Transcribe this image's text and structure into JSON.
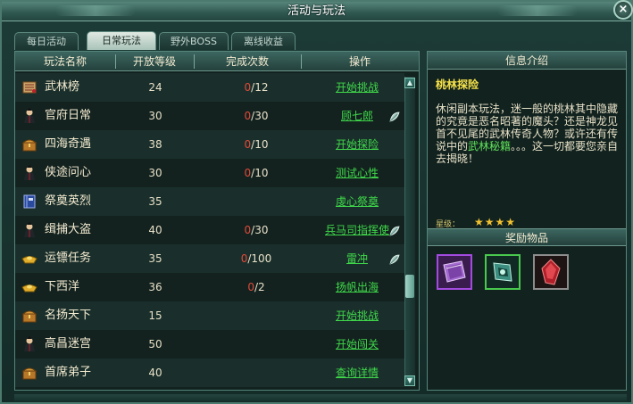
{
  "window": {
    "title": "活动与玩法",
    "close_glyph": "×"
  },
  "tabs": [
    {
      "label": "每日活动",
      "active": false
    },
    {
      "label": "日常玩法",
      "active": true
    },
    {
      "label": "野外BOSS",
      "active": false
    },
    {
      "label": "离线收益",
      "active": false
    }
  ],
  "table": {
    "headers": [
      "玩法名称",
      "开放等级",
      "完成次数",
      "操作"
    ],
    "rows": [
      {
        "icon": "scroll-icon",
        "name": "武林榜",
        "level": "24",
        "done": "0",
        "total": "/12",
        "action": "开始挑战",
        "leaf": false
      },
      {
        "icon": "npc-portrait-icon",
        "name": "官府日常",
        "level": "30",
        "done": "0",
        "total": "/30",
        "action": "顾七郎",
        "leaf": true
      },
      {
        "icon": "chest-icon",
        "name": "四海奇遇",
        "level": "38",
        "done": "0",
        "total": "/10",
        "action": "开始探险",
        "leaf": false
      },
      {
        "icon": "npc-portrait-icon",
        "name": "侠途问心",
        "level": "30",
        "done": "0",
        "total": "/10",
        "action": "测试心性",
        "leaf": false
      },
      {
        "icon": "book-icon",
        "name": "祭奠英烈",
        "level": "35",
        "done": "",
        "total": "",
        "action": "虔心祭奠",
        "leaf": false
      },
      {
        "icon": "npc-portrait-icon",
        "name": "缉捕大盗",
        "level": "40",
        "done": "0",
        "total": "/30",
        "action": "兵马司指挥使",
        "leaf": true
      },
      {
        "icon": "gold-ingot-icon",
        "name": "运镖任务",
        "level": "35",
        "done": "0",
        "total": "/100",
        "action": "雷冲",
        "leaf": true
      },
      {
        "icon": "gold-ingot-icon",
        "name": "下西洋",
        "level": "36",
        "done": "0",
        "total": "/2",
        "action": "扬帆出海",
        "leaf": false
      },
      {
        "icon": "chest-icon",
        "name": "名扬天下",
        "level": "15",
        "done": "",
        "total": "",
        "action": "开始挑战",
        "leaf": false
      },
      {
        "icon": "npc-portrait-icon",
        "name": "高昌迷宫",
        "level": "50",
        "done": "",
        "total": "",
        "action": "开始闯关",
        "leaf": false
      },
      {
        "icon": "chest-icon",
        "name": "首席弟子",
        "level": "40",
        "done": "",
        "total": "",
        "action": "查询详情",
        "leaf": false
      }
    ]
  },
  "info": {
    "header": "信息介绍",
    "title": "桃林探险",
    "text_before": "休闲副本玩法，迷一般的桃林其中隐藏的究竟是恶名昭著的魔头？还是神龙见首不见尾的武林传奇人物？或许还有传说中的",
    "text_highlight": "武林秘籍",
    "text_after": "。。。这一切都要您亲自去揭晓！",
    "star_label": "星级：",
    "stars": "★★★★",
    "rating": 4
  },
  "rewards": {
    "header": "奖励物品",
    "items": [
      {
        "icon": "purple-book-icon",
        "quality": "purple"
      },
      {
        "icon": "green-gem-icon",
        "quality": "green"
      },
      {
        "icon": "red-crystal-icon",
        "quality": "gray"
      }
    ]
  },
  "colors": {
    "done_red": "#e04a3a",
    "action_green": "#3fd74a",
    "title_yellow": "#f5e24a"
  }
}
